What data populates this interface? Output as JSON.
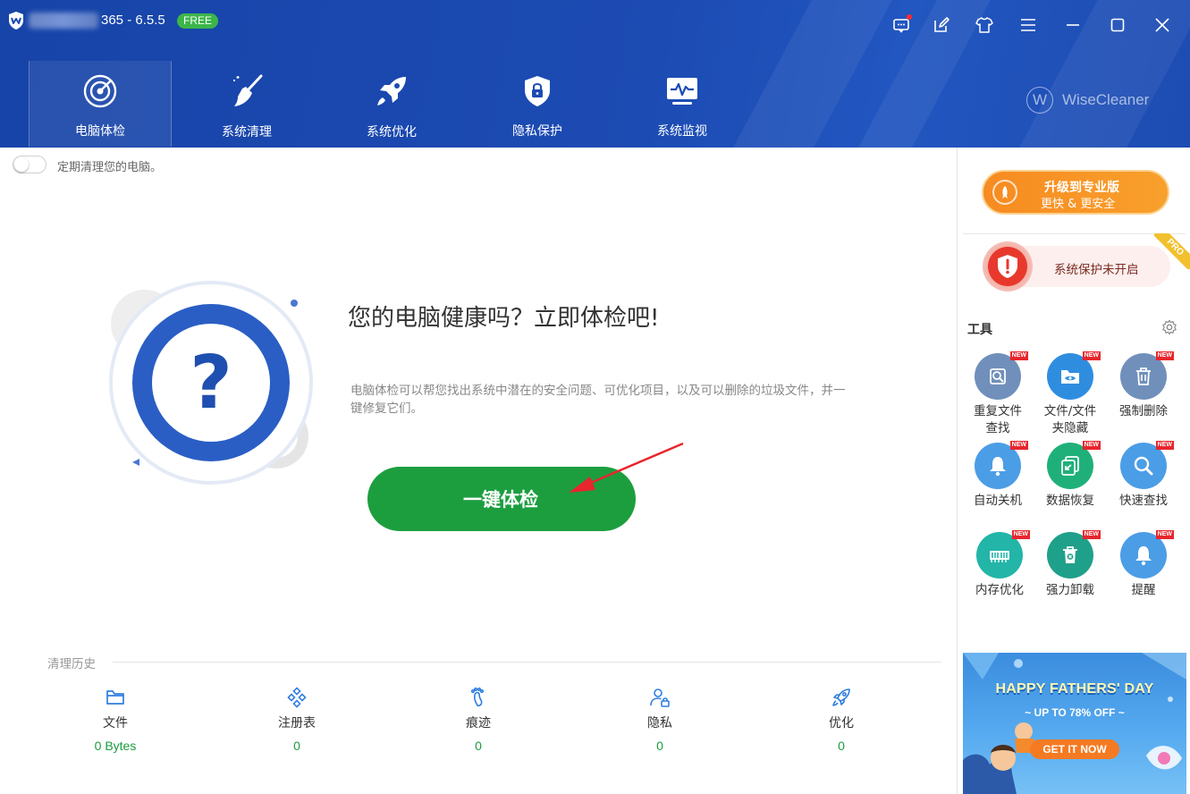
{
  "window": {
    "version": "365 - 6.5.5",
    "badge": "FREE",
    "brand": "WiseCleaner",
    "brand_mark": "W"
  },
  "nav": [
    {
      "label": "电脑体检",
      "icon": "radar-icon",
      "active": true
    },
    {
      "label": "系统清理",
      "icon": "broom-icon",
      "active": false
    },
    {
      "label": "系统优化",
      "icon": "rocket-icon",
      "active": false
    },
    {
      "label": "隐私保护",
      "icon": "shield-lock-icon",
      "active": false
    },
    {
      "label": "系统监视",
      "icon": "monitor-icon",
      "active": false
    }
  ],
  "main": {
    "auto_clean_label": "定期清理您的电脑。",
    "hero_title": "您的电脑健康吗？立即体检吧!",
    "hero_desc": "电脑体检可以帮您找出系统中潜在的安全问题、可优化项目，以及可以删除的垃圾文件，并一键修复它们。",
    "scan_button": "一键体检",
    "history_title": "清理历史",
    "history": [
      {
        "name": "文件",
        "value": "0 Bytes",
        "icon": "folder-icon"
      },
      {
        "name": "注册表",
        "value": "0",
        "icon": "registry-icon"
      },
      {
        "name": "痕迹",
        "value": "0",
        "icon": "footprint-icon"
      },
      {
        "name": "隐私",
        "value": "0",
        "icon": "user-lock-icon"
      },
      {
        "name": "优化",
        "value": "0",
        "icon": "rocket-icon"
      }
    ]
  },
  "side": {
    "upgrade_title": "升级到专业版",
    "upgrade_sub": "更快 & 更安全",
    "protect_text": "系统保护未开启",
    "pro_ribbon": "PRO",
    "tools_title": "工具",
    "new_label": "NEW",
    "tools": [
      {
        "label": "重复文件\n查找",
        "icon": "duplicate-file-icon",
        "color": "#6f8fbd"
      },
      {
        "label": "文件/文件\n夹隐藏",
        "icon": "hide-folder-icon",
        "color": "#2f8de0"
      },
      {
        "label": "强制删除",
        "icon": "trash-icon",
        "color": "#6f8fbd"
      },
      {
        "label": "自动关机",
        "icon": "bell-icon",
        "color": "#4a9ce6"
      },
      {
        "label": "数据恢复",
        "icon": "recover-icon",
        "color": "#1fb07a"
      },
      {
        "label": "快速查找",
        "icon": "search-icon",
        "color": "#4a9ce6"
      },
      {
        "label": "内存优化",
        "icon": "memory-icon",
        "color": "#21b5a8"
      },
      {
        "label": "强力卸载",
        "icon": "uninstall-icon",
        "color": "#1fa08a"
      },
      {
        "label": "提醒",
        "icon": "bell-icon",
        "color": "#4a9ce6"
      }
    ],
    "ad": {
      "title": "HAPPY FATHERS' DAY",
      "subtitle": "~ UP TO 78% OFF ~",
      "button": "GET IT NOW"
    }
  }
}
